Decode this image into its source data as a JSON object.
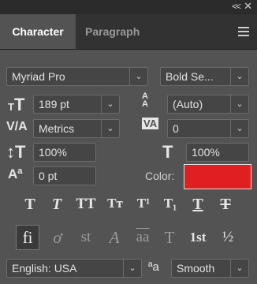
{
  "topbar": {
    "collapse_glyph": "<<",
    "close_glyph": "✕"
  },
  "tabs": {
    "character": "Character",
    "paragraph": "Paragraph"
  },
  "font": {
    "family": "Myriad Pro",
    "style": "Bold Se..."
  },
  "size": {
    "font_size": "189 pt",
    "leading": "(Auto)"
  },
  "spacing": {
    "kerning": "Metrics",
    "tracking": "0"
  },
  "scale": {
    "vertical": "100%",
    "horizontal": "100%"
  },
  "baseline": {
    "shift": "0 pt"
  },
  "color": {
    "label": "Color:",
    "value": "#e02020"
  },
  "type_buttons": [
    "T",
    "T",
    "TT",
    "Tт",
    "T¹",
    "T₁",
    "T",
    "T"
  ],
  "opentype_buttons": [
    "fi",
    "ơ",
    "st",
    "A",
    "aa",
    "T",
    "1st",
    "½"
  ],
  "language": {
    "value": "English: USA"
  },
  "antialias": {
    "icon": "ªa",
    "value": "Smooth"
  }
}
